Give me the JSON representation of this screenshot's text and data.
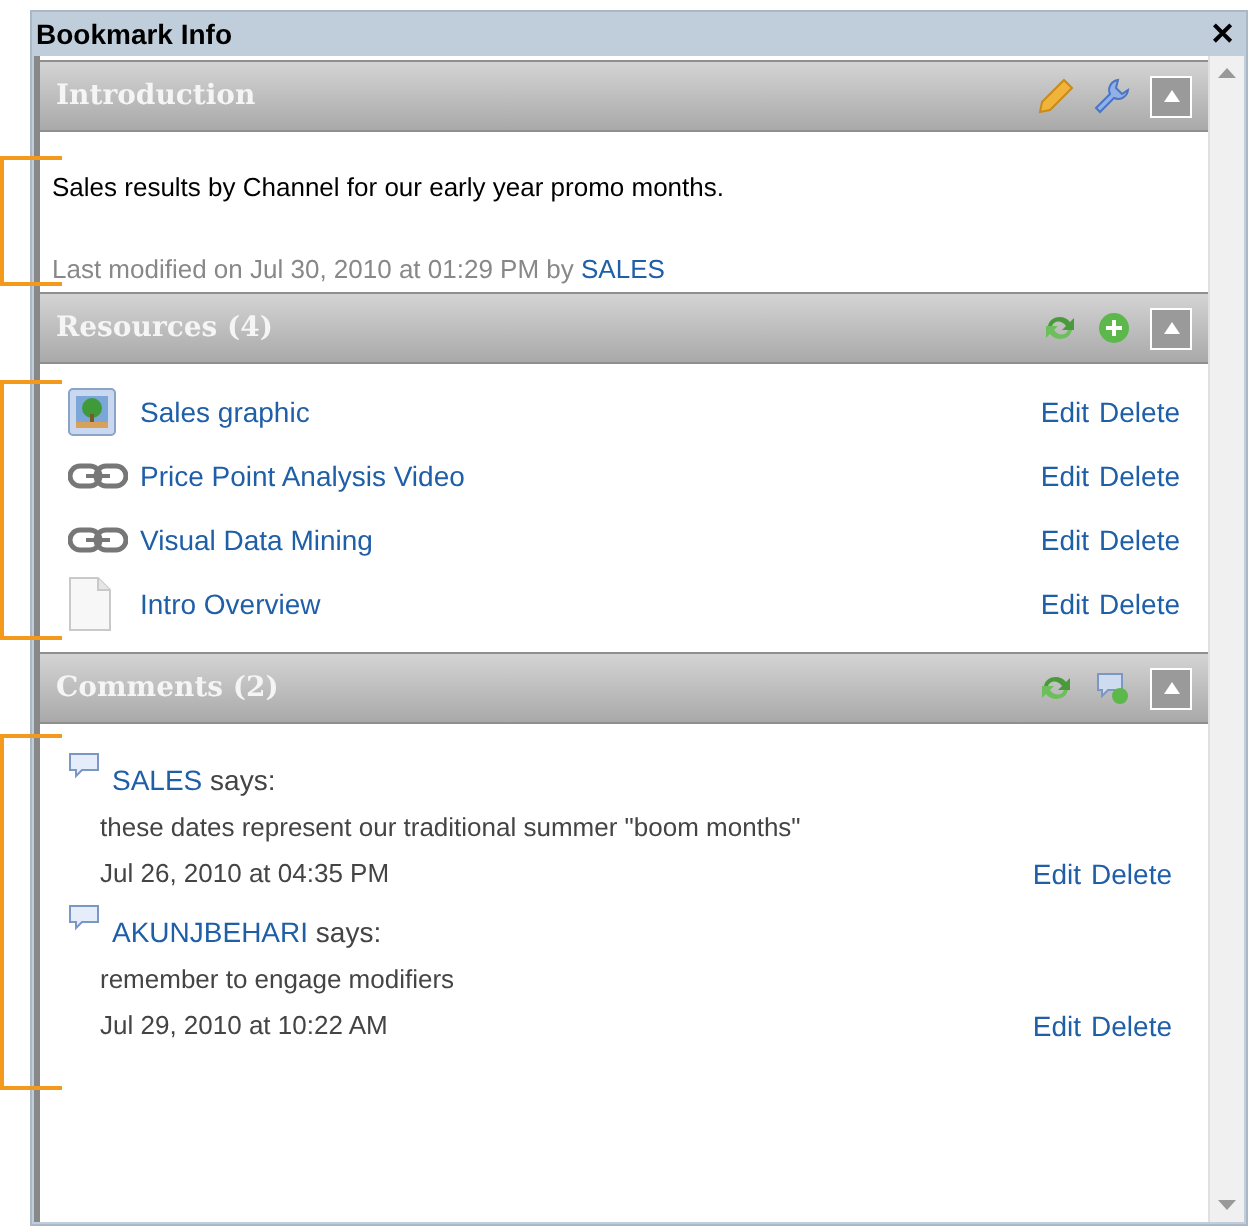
{
  "window": {
    "title": "Bookmark Info",
    "close": "✕"
  },
  "introduction": {
    "title": "Introduction",
    "text": "Sales results by Channel for our early year promo months.",
    "modified": "Last modified on Jul 30, 2010 at 01:29 PM by",
    "modified_by": "SALES"
  },
  "resources": {
    "title": "Resources (4)",
    "items": [
      {
        "kind": "image",
        "name": "Sales graphic",
        "actions": [
          "Edit",
          "Delete"
        ]
      },
      {
        "kind": "link",
        "name": "Price Point Analysis Video",
        "actions": [
          "Edit",
          "Delete"
        ]
      },
      {
        "kind": "link",
        "name": "Visual Data Mining",
        "actions": [
          "Edit",
          "Delete"
        ]
      },
      {
        "kind": "document",
        "name": "Intro Overview",
        "actions": [
          "Edit",
          "Delete"
        ]
      }
    ]
  },
  "comments": {
    "title": "Comments (2)",
    "items": [
      {
        "author": "SALES",
        "says": "says:",
        "text": "these dates represent our traditional summer \"boom months\"",
        "date": "Jul 26, 2010 at 04:35 PM",
        "actions": [
          "Edit",
          "Delete"
        ]
      },
      {
        "author": "AKUNJBEHARI",
        "says": "says:",
        "text": "remember to engage modifiers",
        "date": "Jul 29, 2010 at 10:22 AM",
        "actions": [
          "Edit",
          "Delete"
        ]
      }
    ]
  }
}
